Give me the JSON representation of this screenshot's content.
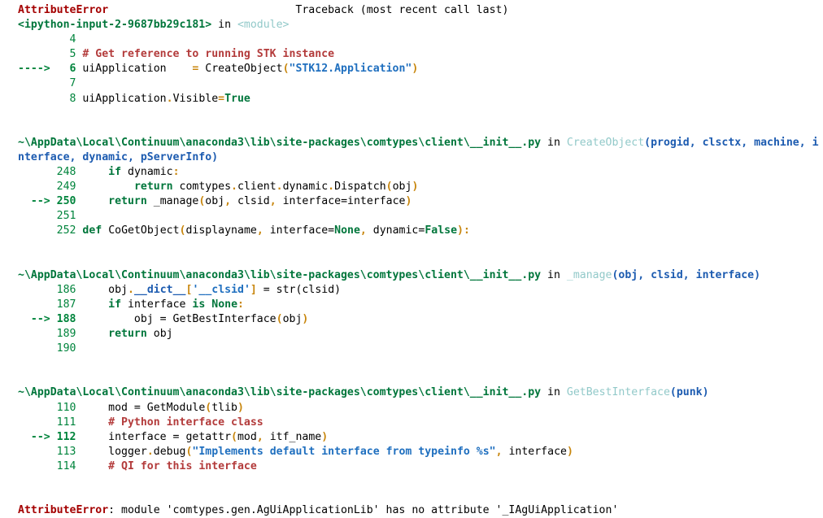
{
  "window": {
    "kind": "ipython-traceback-output",
    "background": "#ffffff"
  },
  "colors": {
    "error": "#a40000",
    "filename": "#00763b",
    "function": "#92c9c9",
    "arguments": "#1c5bb0",
    "lineno": "#00843c",
    "comment": "#b33b3b",
    "keyword": "#00763b",
    "string": "#1f6fbf",
    "operator": "#c8860d",
    "text": "#000000"
  },
  "header": {
    "exception": "AttributeError",
    "traceback_note": "Traceback (most recent call last)"
  },
  "frames": [
    {
      "location": "<ipython-input-2-9687bb29c181>",
      "in_word": "in",
      "scope": "<module>",
      "scope_style": "module",
      "lines": [
        {
          "arrow": "",
          "no": "4",
          "current": false,
          "tokens": []
        },
        {
          "arrow": "",
          "no": "5",
          "current": false,
          "tokens": [
            {
              "t": "comment",
              "v": " # Get reference to running STK instance"
            }
          ]
        },
        {
          "arrow": "---->",
          "no": "6",
          "current": true,
          "tokens": [
            {
              "t": "plain",
              "v": " uiApplication    "
            },
            {
              "t": "op",
              "v": "="
            },
            {
              "t": "plain",
              "v": " CreateObject"
            },
            {
              "t": "op",
              "v": "("
            },
            {
              "t": "str",
              "v": "\"STK12.Application\""
            },
            {
              "t": "op",
              "v": ")"
            }
          ]
        },
        {
          "arrow": "",
          "no": "7",
          "current": false,
          "tokens": []
        },
        {
          "arrow": "",
          "no": "8",
          "current": false,
          "tokens": [
            {
              "t": "plain",
              "v": " uiApplication"
            },
            {
              "t": "op",
              "v": "."
            },
            {
              "t": "plain",
              "v": "Visible"
            },
            {
              "t": "op",
              "v": "="
            },
            {
              "t": "kw",
              "v": "True"
            }
          ]
        }
      ]
    },
    {
      "location": "~\\AppData\\Local\\Continuum\\anaconda3\\lib\\site-packages\\comtypes\\client\\__init__.py",
      "in_word": "in",
      "scope": "CreateObject",
      "scope_style": "function",
      "signature": "(progid, clsctx, machine, interface, dynamic, pServerInfo)",
      "lines": [
        {
          "arrow": "",
          "no": "248",
          "current": false,
          "tokens": [
            {
              "t": "plain",
              "v": "     "
            },
            {
              "t": "kw",
              "v": "if"
            },
            {
              "t": "plain",
              "v": " dynamic"
            },
            {
              "t": "op",
              "v": ":"
            }
          ]
        },
        {
          "arrow": "",
          "no": "249",
          "current": false,
          "tokens": [
            {
              "t": "plain",
              "v": "         "
            },
            {
              "t": "kw",
              "v": "return"
            },
            {
              "t": "plain",
              "v": " comtypes"
            },
            {
              "t": "op",
              "v": "."
            },
            {
              "t": "plain",
              "v": "client"
            },
            {
              "t": "op",
              "v": "."
            },
            {
              "t": "plain",
              "v": "dynamic"
            },
            {
              "t": "op",
              "v": "."
            },
            {
              "t": "plain",
              "v": "Dispatch"
            },
            {
              "t": "op",
              "v": "("
            },
            {
              "t": "plain",
              "v": "obj"
            },
            {
              "t": "op",
              "v": ")"
            }
          ]
        },
        {
          "arrow": "-->",
          "no": "250",
          "current": true,
          "tokens": [
            {
              "t": "plain",
              "v": "     "
            },
            {
              "t": "kw",
              "v": "return"
            },
            {
              "t": "plain",
              "v": " _manage"
            },
            {
              "t": "op",
              "v": "("
            },
            {
              "t": "plain",
              "v": "obj"
            },
            {
              "t": "op",
              "v": ","
            },
            {
              "t": "plain",
              "v": " clsid"
            },
            {
              "t": "op",
              "v": ","
            },
            {
              "t": "plain",
              "v": " interface=interface"
            },
            {
              "t": "op",
              "v": ")"
            }
          ]
        },
        {
          "arrow": "",
          "no": "251",
          "current": false,
          "tokens": []
        },
        {
          "arrow": "",
          "no": "252",
          "current": false,
          "tokens": [
            {
              "t": "plain",
              "v": " "
            },
            {
              "t": "kw",
              "v": "def"
            },
            {
              "t": "plain",
              "v": " CoGetObject"
            },
            {
              "t": "op",
              "v": "("
            },
            {
              "t": "plain",
              "v": "displayname"
            },
            {
              "t": "op",
              "v": ","
            },
            {
              "t": "plain",
              "v": " interface="
            },
            {
              "t": "kw",
              "v": "None"
            },
            {
              "t": "op",
              "v": ","
            },
            {
              "t": "plain",
              "v": " dynamic="
            },
            {
              "t": "kw",
              "v": "False"
            },
            {
              "t": "op",
              "v": "):"
            }
          ]
        }
      ]
    },
    {
      "location": "~\\AppData\\Local\\Continuum\\anaconda3\\lib\\site-packages\\comtypes\\client\\__init__.py",
      "in_word": "in",
      "scope": "_manage",
      "scope_style": "function",
      "signature": "(obj, clsid, interface)",
      "lines": [
        {
          "arrow": "",
          "no": "186",
          "current": false,
          "tokens": [
            {
              "t": "plain",
              "v": "     obj"
            },
            {
              "t": "op",
              "v": "."
            },
            {
              "t": "dunder",
              "v": "__dict__"
            },
            {
              "t": "op",
              "v": "["
            },
            {
              "t": "str",
              "v": "'__clsid'"
            },
            {
              "t": "op",
              "v": "]"
            },
            {
              "t": "plain",
              "v": " = str(clsid)"
            }
          ]
        },
        {
          "arrow": "",
          "no": "187",
          "current": false,
          "tokens": [
            {
              "t": "plain",
              "v": "     "
            },
            {
              "t": "kw",
              "v": "if"
            },
            {
              "t": "plain",
              "v": " interface "
            },
            {
              "t": "kw",
              "v": "is"
            },
            {
              "t": "plain",
              "v": " "
            },
            {
              "t": "kw",
              "v": "None"
            },
            {
              "t": "op",
              "v": ":"
            }
          ]
        },
        {
          "arrow": "-->",
          "no": "188",
          "current": true,
          "tokens": [
            {
              "t": "plain",
              "v": "         obj = GetBestInterface"
            },
            {
              "t": "op",
              "v": "("
            },
            {
              "t": "plain",
              "v": "obj"
            },
            {
              "t": "op",
              "v": ")"
            }
          ]
        },
        {
          "arrow": "",
          "no": "189",
          "current": false,
          "tokens": [
            {
              "t": "plain",
              "v": "     "
            },
            {
              "t": "kw",
              "v": "return"
            },
            {
              "t": "plain",
              "v": " obj"
            }
          ]
        },
        {
          "arrow": "",
          "no": "190",
          "current": false,
          "tokens": []
        }
      ]
    },
    {
      "location": "~\\AppData\\Local\\Continuum\\anaconda3\\lib\\site-packages\\comtypes\\client\\__init__.py",
      "in_word": "in",
      "scope": "GetBestInterface",
      "scope_style": "function",
      "signature": "(punk)",
      "lines": [
        {
          "arrow": "",
          "no": "110",
          "current": false,
          "tokens": [
            {
              "t": "plain",
              "v": "     mod = GetModule"
            },
            {
              "t": "op",
              "v": "("
            },
            {
              "t": "plain",
              "v": "tlib"
            },
            {
              "t": "op",
              "v": ")"
            }
          ]
        },
        {
          "arrow": "",
          "no": "111",
          "current": false,
          "tokens": [
            {
              "t": "comment",
              "v": "     # Python interface class"
            }
          ]
        },
        {
          "arrow": "-->",
          "no": "112",
          "current": true,
          "tokens": [
            {
              "t": "plain",
              "v": "     interface = getattr"
            },
            {
              "t": "op",
              "v": "("
            },
            {
              "t": "plain",
              "v": "mod"
            },
            {
              "t": "op",
              "v": ","
            },
            {
              "t": "plain",
              "v": " itf_name"
            },
            {
              "t": "op",
              "v": ")"
            }
          ]
        },
        {
          "arrow": "",
          "no": "113",
          "current": false,
          "tokens": [
            {
              "t": "plain",
              "v": "     logger"
            },
            {
              "t": "op",
              "v": "."
            },
            {
              "t": "plain",
              "v": "debug"
            },
            {
              "t": "op",
              "v": "("
            },
            {
              "t": "str",
              "v": "\"Implements default interface from typeinfo %s\""
            },
            {
              "t": "op",
              "v": ","
            },
            {
              "t": "plain",
              "v": " interface"
            },
            {
              "t": "op",
              "v": ")"
            }
          ]
        },
        {
          "arrow": "",
          "no": "114",
          "current": false,
          "tokens": [
            {
              "t": "comment",
              "v": "     # QI for this interface"
            }
          ]
        }
      ]
    }
  ],
  "footer": {
    "exception": "AttributeError",
    "message": ": module 'comtypes.gen.AgUiApplicationLib' has no attribute '_IAgUiApplication'"
  },
  "wrapped_header_frame_index": 1,
  "wrapped_header": {
    "line1_tail": "CreateObject(progid, clsctx, machine, inte",
    "line2": "rface, dynamic, pServerInfo)"
  }
}
